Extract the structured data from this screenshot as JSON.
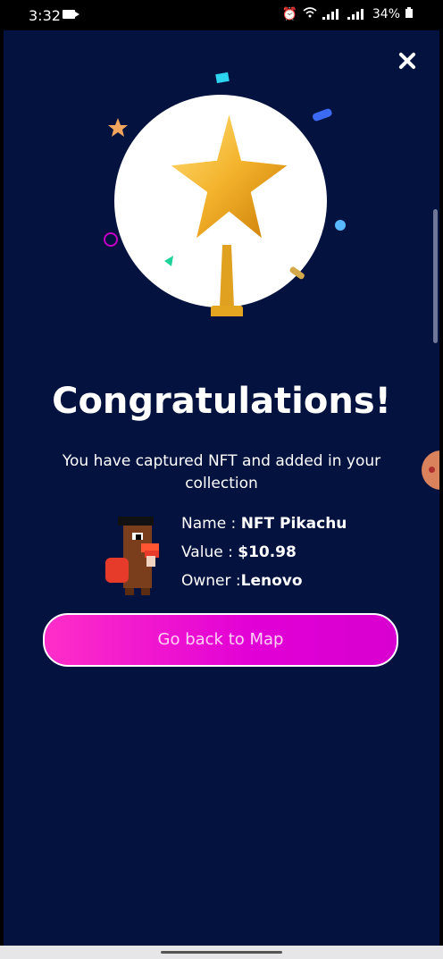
{
  "status_bar": {
    "time": "3:32",
    "battery": "34%"
  },
  "title": "Congratulations!",
  "subtitle": "You have captured NFT and added in your collection",
  "nft": {
    "name_label": "Name :",
    "name_value": "NFT Pikachu",
    "value_label": "Value :",
    "value_value": "$10.98",
    "owner_label": "Owner :",
    "owner_value": "Lenovo"
  },
  "button": {
    "label": "Go back to Map"
  },
  "colors": {
    "background": "#03123f",
    "button": "#e100d6",
    "accent_gold": "#f4b400"
  }
}
